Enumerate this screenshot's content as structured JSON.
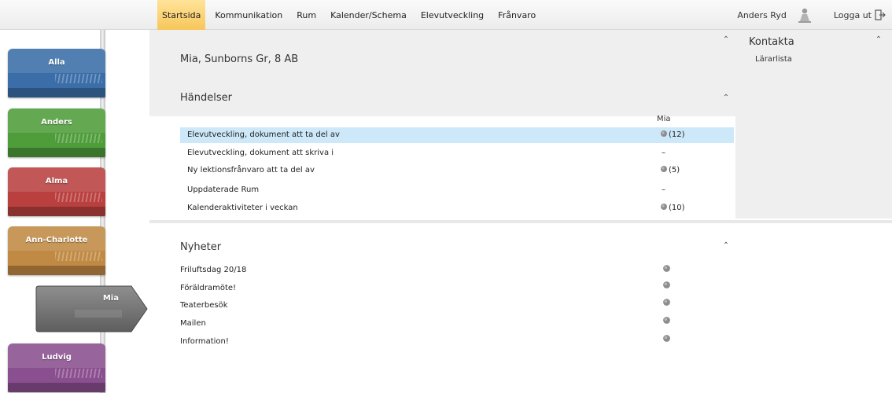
{
  "nav": {
    "items": [
      "Startsida",
      "Kommunikation",
      "Rum",
      "Kalender/Schema",
      "Elevutveckling",
      "Frånvaro"
    ],
    "active_index": 0,
    "user_name": "Anders Ryd",
    "logout_label": "Logga ut"
  },
  "sidebar": {
    "tabs": [
      {
        "label": "Alla",
        "color": "#3b6ea8"
      },
      {
        "label": "Anders",
        "color": "#4f9d3a"
      },
      {
        "label": "Alma",
        "color": "#b9403f"
      },
      {
        "label": "Ann-Charlotte",
        "color": "#c08a44"
      },
      {
        "label": "Mia",
        "color": "#7a7a7a",
        "selected": true
      },
      {
        "label": "Ludvig",
        "color": "#8a4f8f"
      }
    ]
  },
  "student": {
    "title": "Mia, Sunborns Gr, 8 AB"
  },
  "events": {
    "heading": "Händelser",
    "column_label": "Mia",
    "rows": [
      {
        "label": "Elevutveckling, dokument att ta del av",
        "count": "(12)",
        "has_icon": true,
        "highlight": true
      },
      {
        "label": "Elevutveckling, dokument att skriva i",
        "count": "–",
        "has_icon": false
      },
      {
        "label": "Ny lektionsfrånvaro att ta del av",
        "count": "(5)",
        "has_icon": true
      },
      {
        "label": "Uppdaterade Rum",
        "count": "–",
        "has_icon": false
      },
      {
        "label": "Kalenderaktiviteter i veckan",
        "count": "(10)",
        "has_icon": true
      }
    ]
  },
  "news": {
    "heading": "Nyheter",
    "items": [
      "Friluftsdag 20/18",
      "Föräldramöte!",
      "Teaterbesök",
      "Mailen",
      "Information!"
    ]
  },
  "contact": {
    "heading": "Kontakta",
    "link": "Lärarlista"
  },
  "colors": {
    "nav_active": "#f7c65a",
    "row_highlight": "#cde8f8",
    "panel_bg": "#efefef"
  },
  "icons": {
    "collapse": "double-chevron-up-icon",
    "user": "user-icon",
    "logout": "logout-icon",
    "item": "gray-dot-icon"
  }
}
